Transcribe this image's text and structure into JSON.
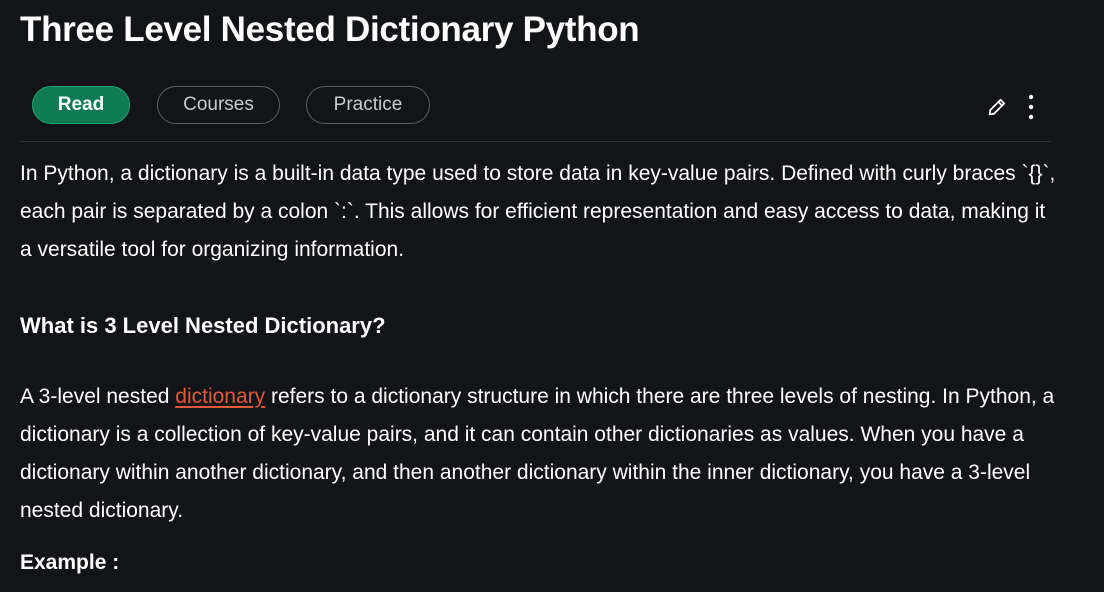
{
  "article": {
    "title": "Three Level Nested Dictionary Python",
    "tabs": {
      "read": "Read",
      "courses": "Courses",
      "practice": "Practice"
    },
    "toolbar": {
      "edit_icon": "pencil-icon",
      "more_icon": "more-vertical-icon"
    },
    "intro": "In Python, a dictionary is a built-in data type used to store data in key-value pairs. Defined with curly braces `{}`, each pair is separated by a colon `:`. This allows for efficient representation and easy access to data, making it a versatile tool for organizing information.",
    "section_heading": "What is 3 Level Nested Dictionary?",
    "body": {
      "before_link": "A 3-level nested ",
      "link_text": "dictionary",
      "after_link": " refers to a dictionary structure in which there are three levels of nesting. In Python, a dictionary is a collection of key-value pairs, and it can contain other dictionaries as values. When you have a dictionary within another dictionary, and then another dictionary within the inner dictionary, you have a 3-level nested dictionary."
    },
    "example_label": "Example :"
  },
  "colors": {
    "background": "#131417",
    "accent_green": "#0f7a54",
    "link": "#e05a3a"
  }
}
